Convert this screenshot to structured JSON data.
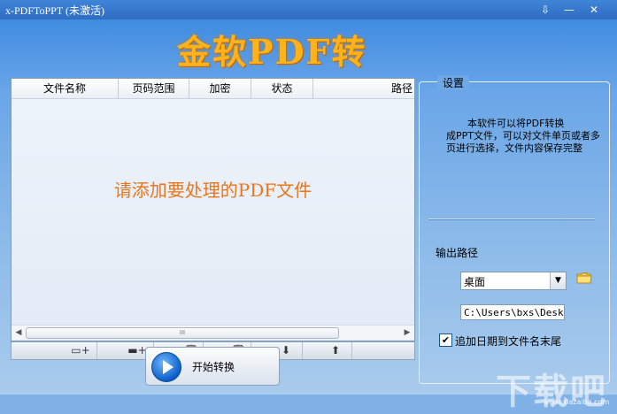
{
  "window": {
    "title": "x-PDFToPPT (未激活)",
    "controls": [
      "⇩",
      "—",
      "✕"
    ]
  },
  "banner": {
    "text": "金软PDF转PPT"
  },
  "file_list": {
    "columns": [
      "文件名称",
      "页码范围",
      "加密",
      "状态",
      "路径"
    ],
    "placeholder": "请添加要处理的PDF文件",
    "scroll_thumb_grip": "III"
  },
  "toolbar": {
    "buttons": [
      {
        "name": "add-file",
        "glyph": "▭+"
      },
      {
        "name": "add-folder",
        "glyph": "▬+"
      },
      {
        "name": "remove-checked",
        "glyph": "✓🗑"
      },
      {
        "name": "remove-all",
        "glyph": "⧉🗑"
      },
      {
        "name": "move-down",
        "glyph": "⬇"
      },
      {
        "name": "move-up",
        "glyph": "⬆"
      }
    ]
  },
  "start_button": {
    "label": "开始转换"
  },
  "settings": {
    "legend": "设置",
    "description_line1": "本软件可以将PDF转换",
    "description_rest": "成PPT文件，可以对文件单页或者多页进行选择，文件内容保存完整",
    "output_label": "输出路径",
    "output_select_value": "桌面",
    "output_path": "C:\\Users\\bxs\\Desktc",
    "append_date_checked": true,
    "append_date_label": "追加日期到文件名末尾"
  },
  "watermark": {
    "text": "下载吧",
    "url": "www.xiazaiba.com"
  },
  "colors": {
    "banner": "#ffb21a",
    "placeholder": "#e8761b",
    "titlebar": "#2f6cc1"
  }
}
